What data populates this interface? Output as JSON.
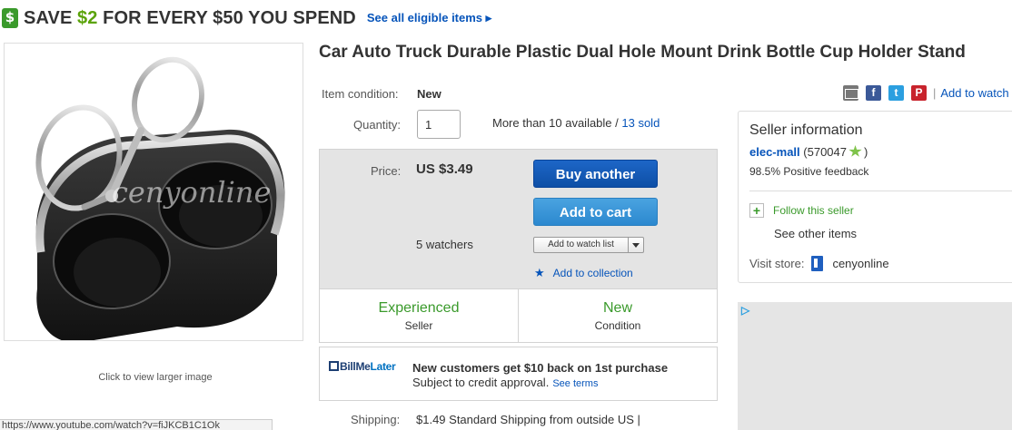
{
  "promo": {
    "prefix": "SAVE ",
    "amount": "$2",
    "suffix": " FOR EVERY $50 YOU SPEND",
    "link": "See all eligible items ▸"
  },
  "image": {
    "watermark": "cenyonline",
    "caption": "Click to view larger image"
  },
  "status_bar": {
    "url": "https://www.youtube.com/watch?v=fiJKCB1C1Ok"
  },
  "title": "Car Auto Truck Durable Plastic Dual Hole Mount Drink Bottle Cup Holder Stand",
  "condition": {
    "label": "Item condition:",
    "value": "New"
  },
  "quantity": {
    "label": "Quantity:",
    "value": "1",
    "availability": "More than 10 available / ",
    "sold": "13 sold"
  },
  "price": {
    "label": "Price:",
    "value": "US $3.49",
    "buy_label": "Buy another",
    "cart_label": "Add to cart",
    "watchers": "5 watchers",
    "watch_button": "Add to watch list",
    "collection_link": "Add to collection"
  },
  "badges": [
    {
      "top": "Experienced",
      "bottom": "Seller"
    },
    {
      "top": "New",
      "bottom": "Condition"
    }
  ],
  "billmelater": {
    "logo_bill": "Bill",
    "logo_me": "Me",
    "logo_later": "Later",
    "headline": "New customers get $10 back on 1st purchase",
    "sub": "Subject to credit approval.",
    "terms": "See terms"
  },
  "shipping": {
    "label": "Shipping:",
    "value": "$1.49  Standard Shipping from outside US |"
  },
  "share": {
    "separator": "|",
    "watch_link": "Add to watch list"
  },
  "seller": {
    "title": "Seller information",
    "name": "elec-mall",
    "score": "(570047",
    "score_close": ")",
    "feedback": "98.5% Positive feedback",
    "follow": "Follow this seller",
    "other_items": "See other items",
    "visit_label": "Visit store:",
    "store_name": "cenyonline"
  },
  "colors": {
    "primary_button": "#0e4fa6",
    "secondary_button": "#2b88cf",
    "link": "#0654ba",
    "positive": "#3a9a2b"
  },
  "icons": [
    "dollar-tag-icon",
    "email-icon",
    "facebook-icon",
    "twitter-icon",
    "pinterest-icon",
    "star-icon",
    "plus-icon",
    "store-icon",
    "adchoices-icon",
    "dropdown-arrow-icon"
  ]
}
